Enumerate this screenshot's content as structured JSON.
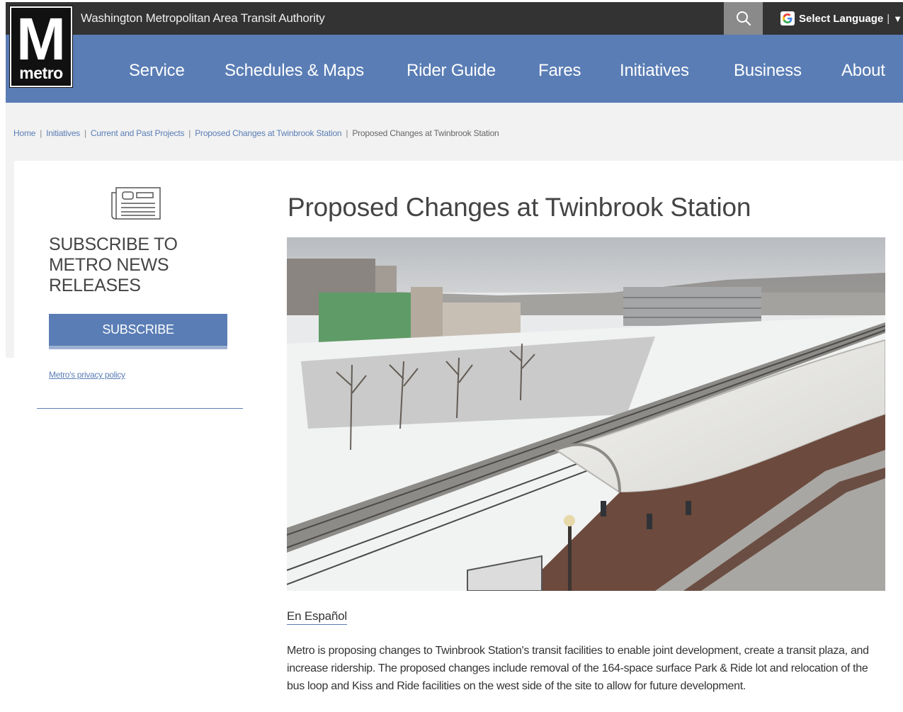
{
  "header": {
    "org_name": "Washington Metropolitan Area Transit Authority",
    "language_label": "Select Language",
    "language_separator": "|",
    "language_caret": "▼",
    "logo_letter": "M",
    "logo_text": "metro"
  },
  "nav": {
    "items": [
      "Service",
      "Schedules & Maps",
      "Rider Guide",
      "Fares",
      "Initiatives",
      "Business",
      "About"
    ]
  },
  "breadcrumb": {
    "items": [
      "Home",
      "Initiatives",
      "Current and Past Projects",
      "Proposed Changes at Twinbrook Station"
    ],
    "current": "Proposed Changes at Twinbrook Station",
    "separator": "|"
  },
  "sidebar": {
    "subscribe_title": "SUBSCRIBE TO METRO NEWS RELEASES",
    "subscribe_button": "SUBSCRIBE",
    "privacy_link": "Metro's privacy policy"
  },
  "main": {
    "title": "Proposed Changes at Twinbrook Station",
    "espanol_link": "En Español",
    "body": "Metro is proposing changes to Twinbrook Station's transit facilities to enable joint development, create a transit plaza, and increase ridership. The proposed changes include removal of the 164-space surface Park & Ride lot and relocation of the bus loop and Kiss and Ride facilities on the west side of the site to allow for future development."
  },
  "colors": {
    "topbar": "#333333",
    "nav": "#5a7db5",
    "accent": "#5a7db5"
  }
}
